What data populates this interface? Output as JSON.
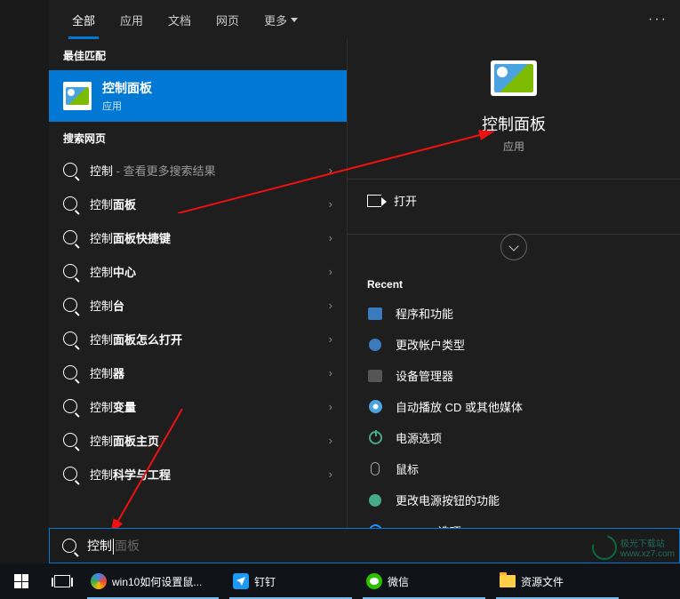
{
  "tabs": {
    "all": "全部",
    "apps": "应用",
    "docs": "文档",
    "web": "网页",
    "more": "更多"
  },
  "sections": {
    "best_match": "最佳匹配",
    "search_web": "搜索网页"
  },
  "best_match": {
    "title": "控制面板",
    "subtitle": "应用"
  },
  "results": [
    {
      "pre": "控制",
      "post": "",
      "suffix": " - 查看更多搜索结果"
    },
    {
      "pre": "控制",
      "post": "面板",
      "suffix": ""
    },
    {
      "pre": "控制",
      "post": "面板快捷键",
      "suffix": ""
    },
    {
      "pre": "控制",
      "post": "中心",
      "suffix": ""
    },
    {
      "pre": "控制",
      "post": "台",
      "suffix": ""
    },
    {
      "pre": "控制",
      "post": "面板怎么打开",
      "suffix": ""
    },
    {
      "pre": "控制",
      "post": "器",
      "suffix": ""
    },
    {
      "pre": "控制",
      "post": "变量",
      "suffix": ""
    },
    {
      "pre": "控制",
      "post": "面板主页",
      "suffix": ""
    },
    {
      "pre": "控制",
      "post": "科学与工程",
      "suffix": ""
    }
  ],
  "preview": {
    "title": "控制面板",
    "subtitle": "应用",
    "open": "打开",
    "recent_header": "Recent",
    "recent": [
      {
        "icon": "ico-box",
        "label": "程序和功能"
      },
      {
        "icon": "ico-user",
        "label": "更改帐户类型"
      },
      {
        "icon": "ico-dev",
        "label": "设备管理器"
      },
      {
        "icon": "ico-cd",
        "label": "自动播放 CD 或其他媒体"
      },
      {
        "icon": "ico-power",
        "label": "电源选项"
      },
      {
        "icon": "ico-mouse",
        "label": "鼠标"
      },
      {
        "icon": "ico-btn",
        "label": "更改电源按钮的功能"
      },
      {
        "icon": "ico-ie",
        "label": "Internet 选项"
      }
    ]
  },
  "search_input": {
    "typed": "控制",
    "hint": "面板"
  },
  "taskbar": {
    "edge_title": "win10如何设置鼠...",
    "dingtalk": "钉钉",
    "wechat": "微信",
    "folder": "资源文件"
  },
  "watermark": {
    "text": "极光下载站",
    "url": "www.xz7.com"
  }
}
